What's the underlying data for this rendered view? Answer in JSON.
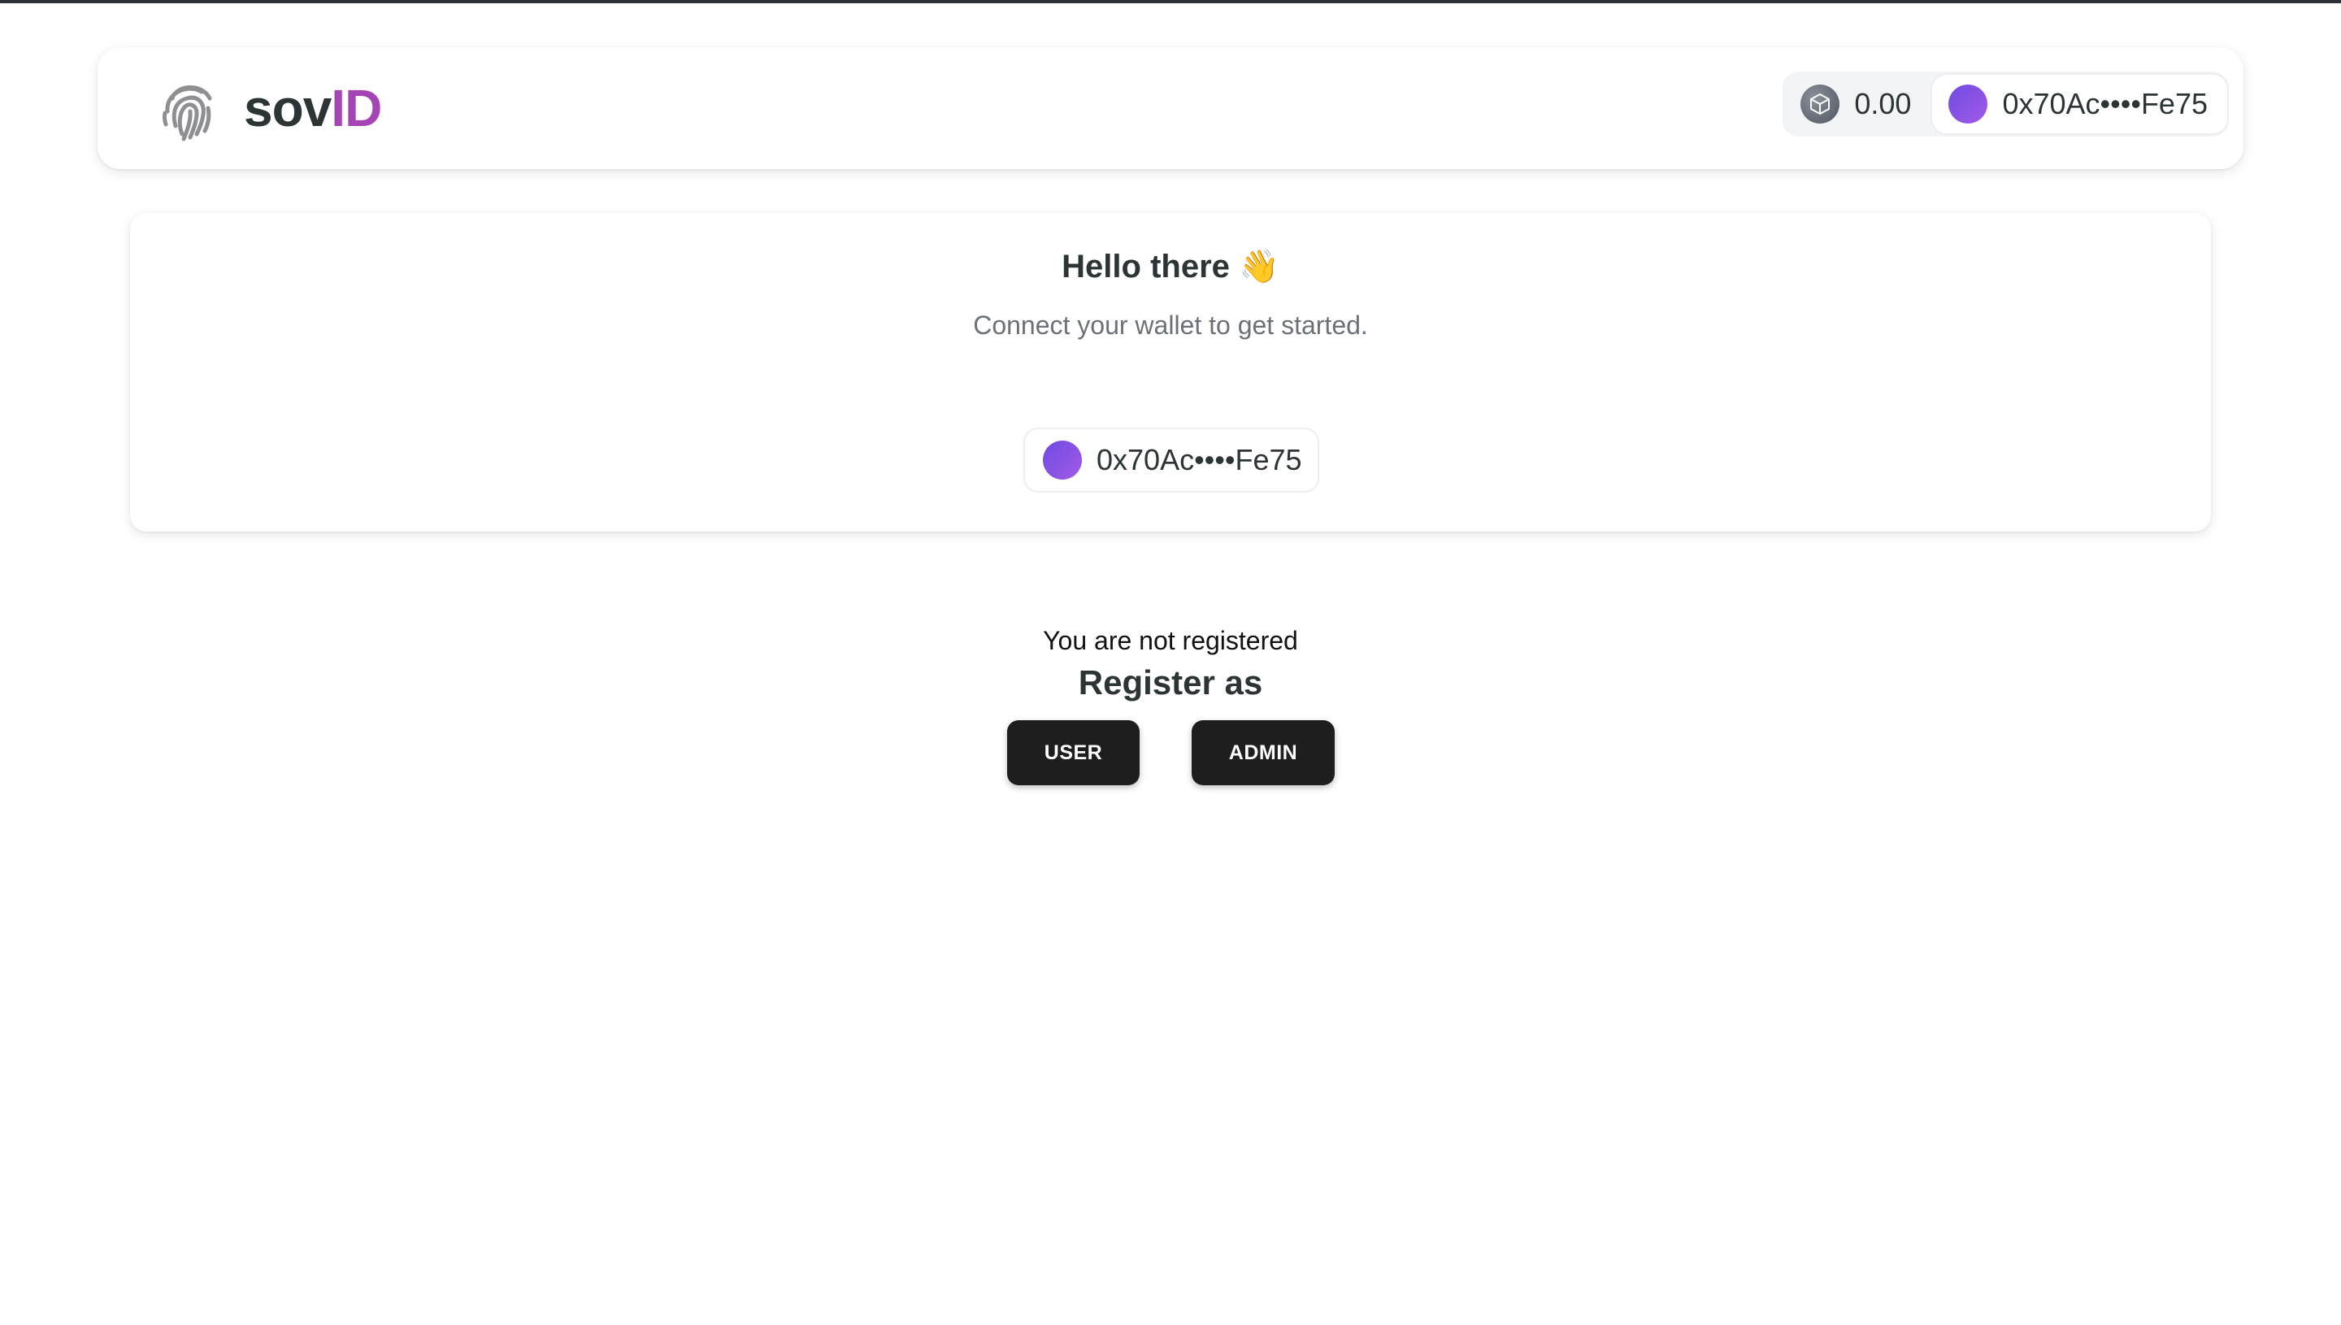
{
  "header": {
    "brand_prefix": "sov",
    "brand_accent": "ID",
    "logo_icon": "fingerprint-icon",
    "balance": "0.00",
    "chain_icon": "cube-icon",
    "account_address": "0x70Ac••••Fe75"
  },
  "connect_card": {
    "title": "Hello there 👋",
    "subtitle": "Connect your wallet to get started.",
    "account_address": "0x70Ac••••Fe75"
  },
  "registration": {
    "status_text": "You are not registered",
    "heading": "Register as",
    "user_button_label": "USER",
    "admin_button_label": "ADMIN"
  },
  "colors": {
    "brand_accent": "#a544b5",
    "avatar_start": "#6f4ae3",
    "avatar_end": "#a25be6",
    "button_bg": "#1e1e1e"
  }
}
